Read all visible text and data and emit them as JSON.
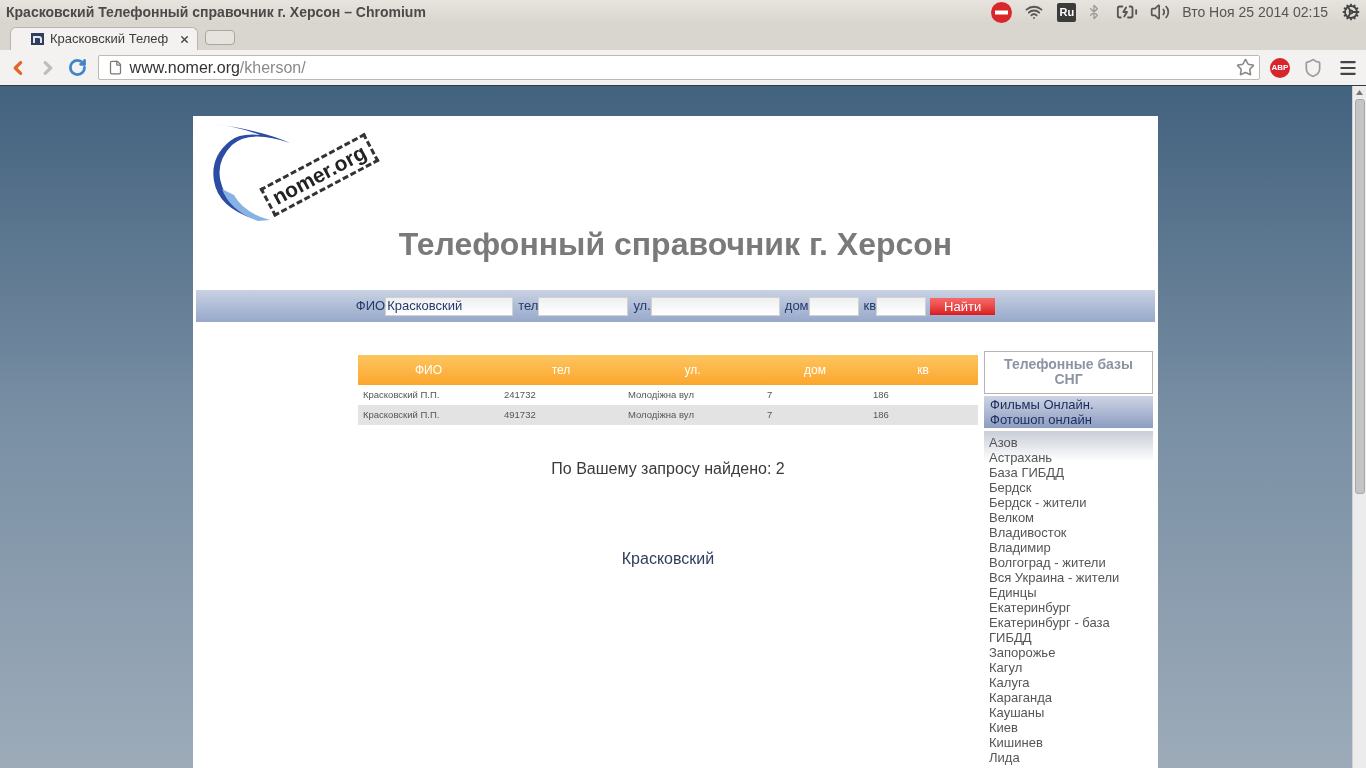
{
  "top_panel": {
    "window_title": "Красковский Телефонный справочник г. Херсон – Chromium",
    "keyboard_layout": "Ru",
    "clock": "Вто Ноя 25 2014 02:15"
  },
  "browser": {
    "tabs": [
      {
        "title": "Красковский Телеф",
        "selected": true
      }
    ],
    "address": {
      "host": "www.nomer.org",
      "path": "/kherson/"
    },
    "extensions": [
      {
        "kind": "adblock",
        "label": "ABP"
      },
      {
        "kind": "shield"
      }
    ]
  },
  "page": {
    "logo_text": "nomer.org",
    "title": "Телефонный справочник г. Херсон",
    "search_form": {
      "fields": [
        {
          "label": "ФИО",
          "value": "Красковский"
        },
        {
          "label": "тел"
        },
        {
          "label": "ул."
        },
        {
          "label": "дом"
        },
        {
          "label": "кв"
        }
      ],
      "submit": "Найти"
    },
    "results_table": {
      "columns": [
        "ФИО",
        "тел",
        "ул.",
        "дом",
        "кв"
      ],
      "rows": [
        [
          "Красковский П.П.",
          "241732",
          "Молодіжна вул",
          "7",
          "186"
        ],
        [
          "Красковский П.П.",
          "491732",
          "Молодіжна вул",
          "7",
          "186"
        ]
      ]
    },
    "result_count": "По Вашему запросу найдено: 2",
    "query": "Красковский"
  },
  "sidebar": {
    "heading": "Телефонные базы СНГ",
    "promo_links": [
      "Фильмы Онлайн.",
      "Фотошоп онлайн"
    ],
    "city_links": [
      "Азов",
      "Астрахань",
      "База ГИБДД",
      "Бердск",
      "Бердск - жители",
      "Велком",
      "Владивосток",
      "Владимир",
      "Волгоград - жители",
      "Вся Украина - жители",
      "Единцы",
      "Екатеринбург",
      "Екатеринбург - база ГИБДД",
      "Запорожье",
      "Кагул",
      "Калуга",
      "Караганда",
      "Каушаны",
      "Киев",
      "Кишинев",
      "Лида"
    ]
  }
}
